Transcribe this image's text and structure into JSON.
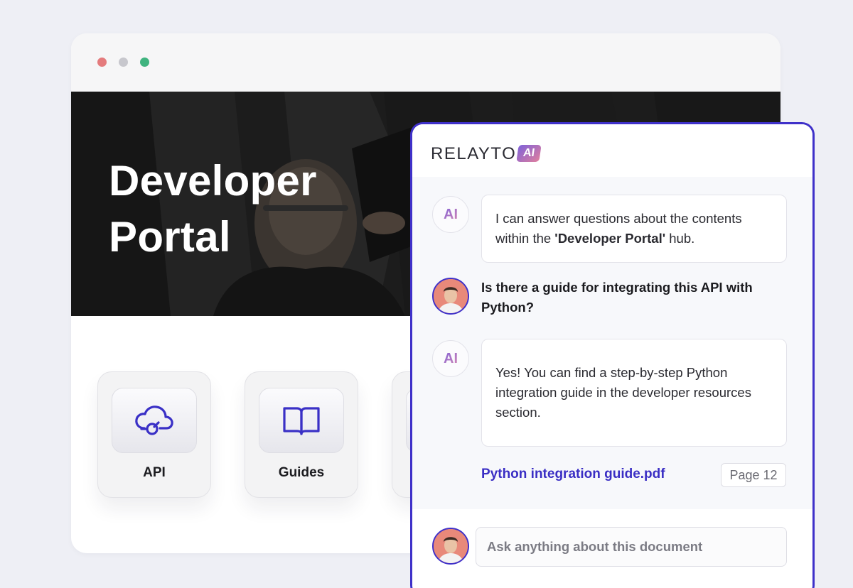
{
  "browser": {
    "hero_title": "Developer\nPortal",
    "cards": [
      {
        "label": "API",
        "icon": "cloud-connect-icon"
      },
      {
        "label": "Guides",
        "icon": "open-book-icon"
      },
      {
        "label": "",
        "icon": ""
      }
    ]
  },
  "chat": {
    "brand": "RELAYTO",
    "brand_badge": "AI",
    "ai_avatar_label": "AI",
    "messages": {
      "intro_pre": "I can answer questions about the contents within the ",
      "intro_bold": "'Developer Portal'",
      "intro_post": " hub.",
      "user_question": "Is there a guide for integrating this API with Python?",
      "answer": "Yes! You can find a step-by-step Python integration guide in the developer resources section."
    },
    "source": {
      "filename": "Python integration guide.pdf",
      "page": "Page 12"
    },
    "input_placeholder": "Ask anything about this document"
  },
  "colors": {
    "accent": "#3f31c9",
    "hero_bg": "#1f1f1f",
    "page_bg": "#eeeff5"
  }
}
